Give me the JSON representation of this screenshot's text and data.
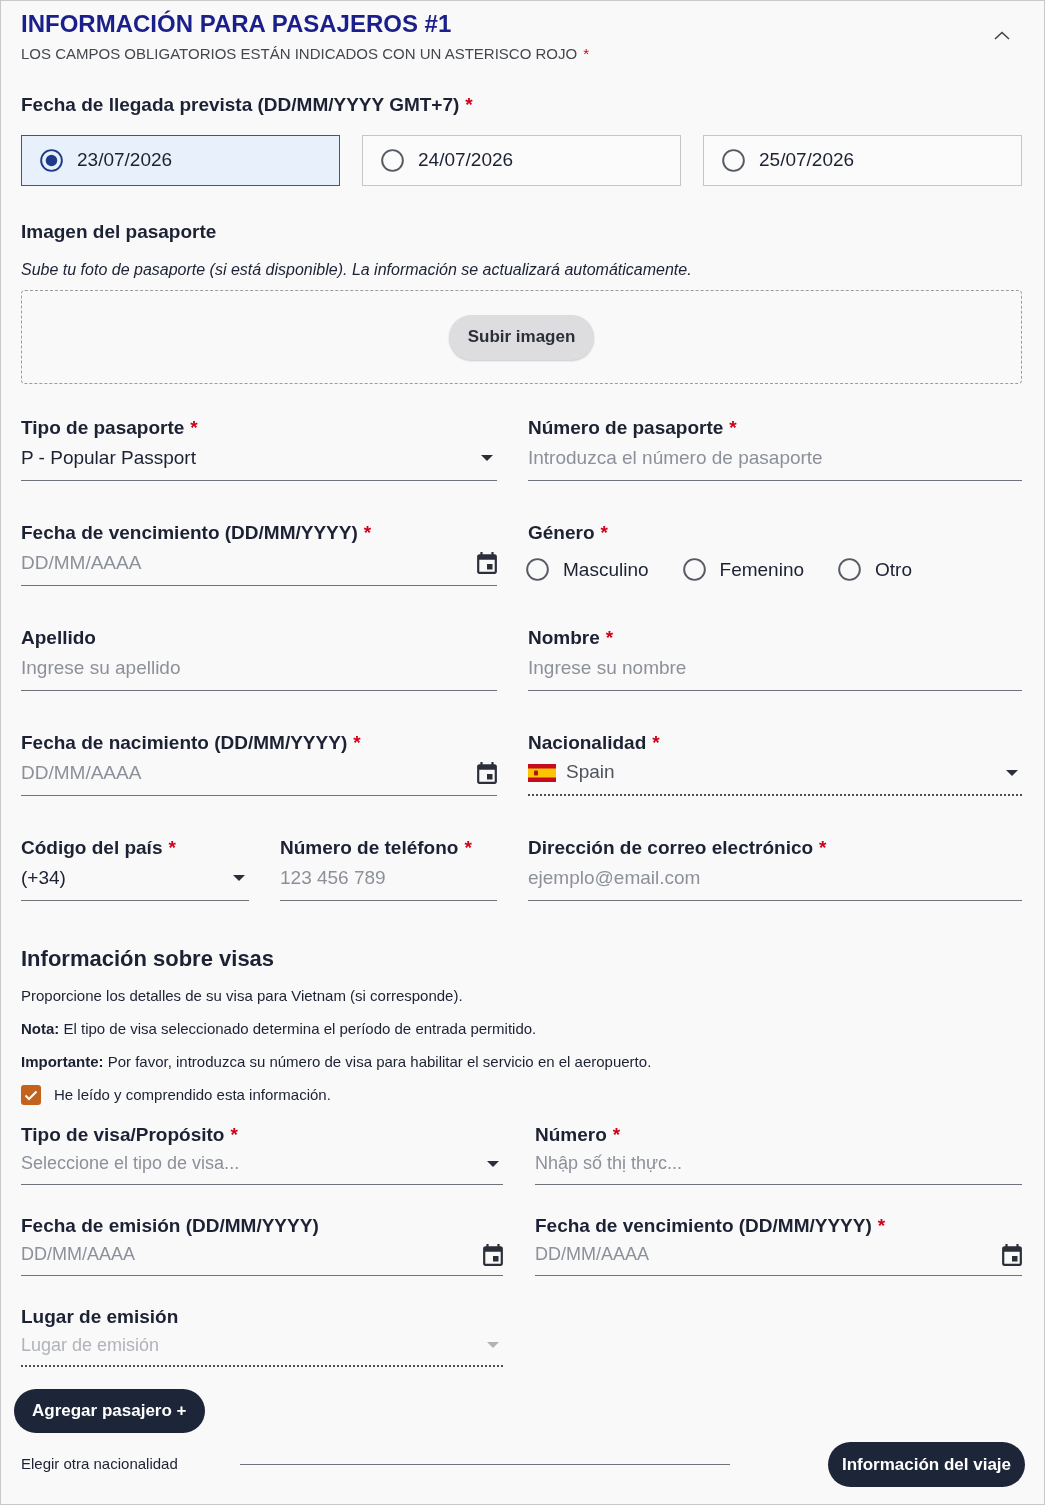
{
  "header": {
    "title": "INFORMACIÓN PARA PASAJEROS #1",
    "note": "LOS CAMPOS OBLIGATORIOS ESTÁN INDICADOS CON UN ASTERISCO ROJO",
    "asterisk": "*",
    "expanded": true
  },
  "arrival": {
    "label": "Fecha de llegada prevista (DD/MM/YYYY GMT+7)",
    "asterisk": "*",
    "options": [
      {
        "label": "23/07/2026",
        "selected": true
      },
      {
        "label": "24/07/2026",
        "selected": false
      },
      {
        "label": "25/07/2026",
        "selected": false
      }
    ]
  },
  "passport_image": {
    "label": "Imagen del pasaporte",
    "hint": "Sube tu foto de pasaporte (si está disponible). La información se actualizará automáticamente.",
    "button": "Subir imagen"
  },
  "passenger_rows": [
    [
      {
        "kind": "select",
        "label": "Tipo de pasaporte",
        "asterisk": "*",
        "value": "P - Popular Passport",
        "disabled": false
      },
      {
        "kind": "text",
        "label": "Número de pasaporte",
        "asterisk": "*",
        "placeholder": "Introduzca el número de pasaporte",
        "disabled": false
      }
    ],
    [
      {
        "kind": "date",
        "label": "Fecha de vencimiento (DD/MM/YYYY)",
        "asterisk": "*",
        "placeholder": "DD/MM/AAAA",
        "disabled": false
      },
      {
        "kind": "radio",
        "label": "Género",
        "asterisk": "*",
        "disabled": false,
        "options": [
          {
            "label": "Masculino",
            "selected": false
          },
          {
            "label": "Femenino",
            "selected": false
          },
          {
            "label": "Otro",
            "selected": false
          }
        ]
      }
    ],
    [
      {
        "kind": "text",
        "label": "Apellido",
        "placeholder": "Ingrese su apellido",
        "disabled": false
      },
      {
        "kind": "text",
        "label": "Nombre",
        "asterisk": "*",
        "placeholder": "Ingrese su nombre",
        "disabled": false
      }
    ],
    [
      {
        "kind": "date",
        "label": "Fecha de nacimiento (DD/MM/YYYY)",
        "asterisk": "*",
        "placeholder": "DD/MM/AAAA",
        "disabled": false
      },
      {
        "kind": "flag_select",
        "label": "Nacionalidad",
        "asterisk": "*",
        "value": "Spain",
        "disabled": false
      }
    ],
    [
      {
        "kind": "select",
        "label": "Código del país",
        "asterisk": "*",
        "value": "(+34)",
        "disabled": false
      },
      {
        "kind": "text",
        "label": "Número de teléfono",
        "asterisk": "*",
        "placeholder": "123 456 789",
        "disabled": false
      },
      {
        "kind": "text",
        "label": "Dirección de correo electrónico",
        "asterisk": "*",
        "placeholder": "ejemplo@email.com",
        "disabled": false
      }
    ]
  ],
  "visa": {
    "title": "Información sobre visas",
    "paragraphs": [
      "Proporcione los detalles de su visa para Vietnam (si corresponde).",
      "**Nota:** El tipo de visa seleccionado determina el período de entrada permitido.",
      "**Importante:** Por favor, introduzca su número de visa para habilitar el servicio en el aeropuerto."
    ],
    "acknowledge": {
      "label": "He leído y comprendido esta información.",
      "checked": true
    },
    "rows": [
      [
        {
          "kind": "select",
          "label": "Tipo de visa/Propósito",
          "asterisk": "*",
          "placeholder": "Seleccione el tipo de visa...",
          "disabled": false
        },
        {
          "kind": "text",
          "label": "Número",
          "asterisk": "*",
          "placeholder": "Nhập số thị thực...",
          "disabled": false
        }
      ],
      [
        {
          "kind": "date",
          "label": "Fecha de emisión (DD/MM/YYYY)",
          "placeholder": "DD/MM/AAAA",
          "disabled": false
        },
        {
          "kind": "date",
          "label": "Fecha de vencimiento (DD/MM/YYYY)",
          "asterisk": "*",
          "placeholder": "DD/MM/AAAA",
          "disabled": false
        }
      ],
      [
        {
          "kind": "select",
          "label": "Lugar de emisión",
          "placeholder": "Lugar de emisión",
          "disabled": true
        }
      ]
    ]
  },
  "actions": {
    "add_passenger": "Agregar pasajero +",
    "other_nationality": "Elegir otra nacionalidad",
    "trip_info": "Información del viaje"
  }
}
